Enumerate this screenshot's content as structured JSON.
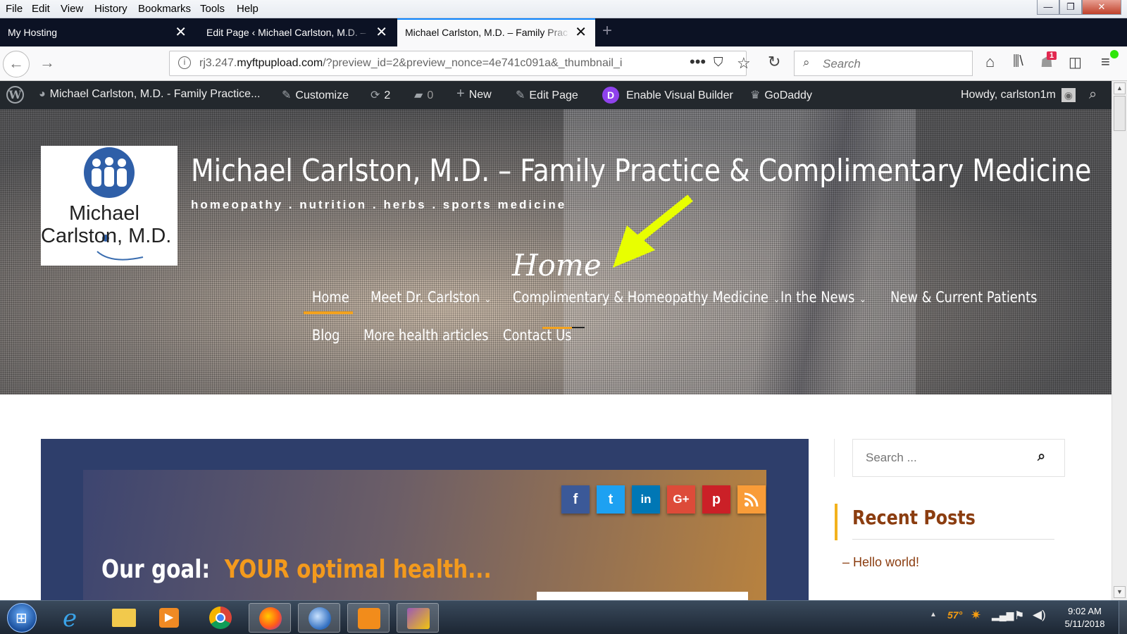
{
  "menubar": {
    "items": [
      "File",
      "Edit",
      "View",
      "History",
      "Bookmarks",
      "Tools",
      "Help"
    ],
    "window_controls": [
      "minimize",
      "restore",
      "close"
    ]
  },
  "tabs": [
    {
      "label": "My Hosting",
      "active": false
    },
    {
      "label": "Edit Page ‹ Michael Carlston, M.D. –",
      "active": false
    },
    {
      "label": "Michael Carlston, M.D. – Family Prac",
      "active": true
    }
  ],
  "navbar": {
    "url_prefix": "rj3.247.",
    "url_domain": "myftpupload.com",
    "url_rest": "/?preview_id=2&preview_nonce=4e741c091a&_thumbnail_i",
    "search_placeholder": "Search",
    "notification_badge": "1"
  },
  "wpbar": {
    "site_name": "Michael Carlston, M.D. - Family Practice...",
    "customize": "Customize",
    "updates_count": "2",
    "comments_count": "0",
    "new": "New",
    "edit_page": "Edit Page",
    "visual_builder": "Enable Visual Builder",
    "godaddy": "GoDaddy",
    "howdy": "Howdy, carlston1m"
  },
  "hero": {
    "logo_line1": "Michael",
    "logo_line2": "Carlston, M.D.",
    "title": "Michael Carlston, M.D. – Family Practice & Complimentary Medicine",
    "tagline": "homeopathy . nutrition . herbs . sports medicine",
    "home_script": "Home",
    "nav": [
      {
        "label": "Home"
      },
      {
        "label": "Meet Dr. Carlston"
      },
      {
        "label": "Complimentary & Homeopathy Medicine"
      },
      {
        "label": "In the News"
      },
      {
        "label": "New & Current Patients"
      },
      {
        "label": "Blog"
      },
      {
        "label": "More health articles"
      },
      {
        "label": "Contact Us"
      }
    ]
  },
  "content": {
    "social": [
      "f",
      "t",
      "in",
      "G+",
      "p",
      "rss"
    ],
    "goal_label": "Our goal:",
    "goal_highlight": "YOUR optimal health..."
  },
  "sidebar": {
    "search_placeholder": "Search ...",
    "recent_title": "Recent Posts",
    "posts": [
      "Hello world!"
    ]
  },
  "taskbar": {
    "time": "9:02 AM",
    "date": "5/11/2018",
    "temp": "57°"
  }
}
